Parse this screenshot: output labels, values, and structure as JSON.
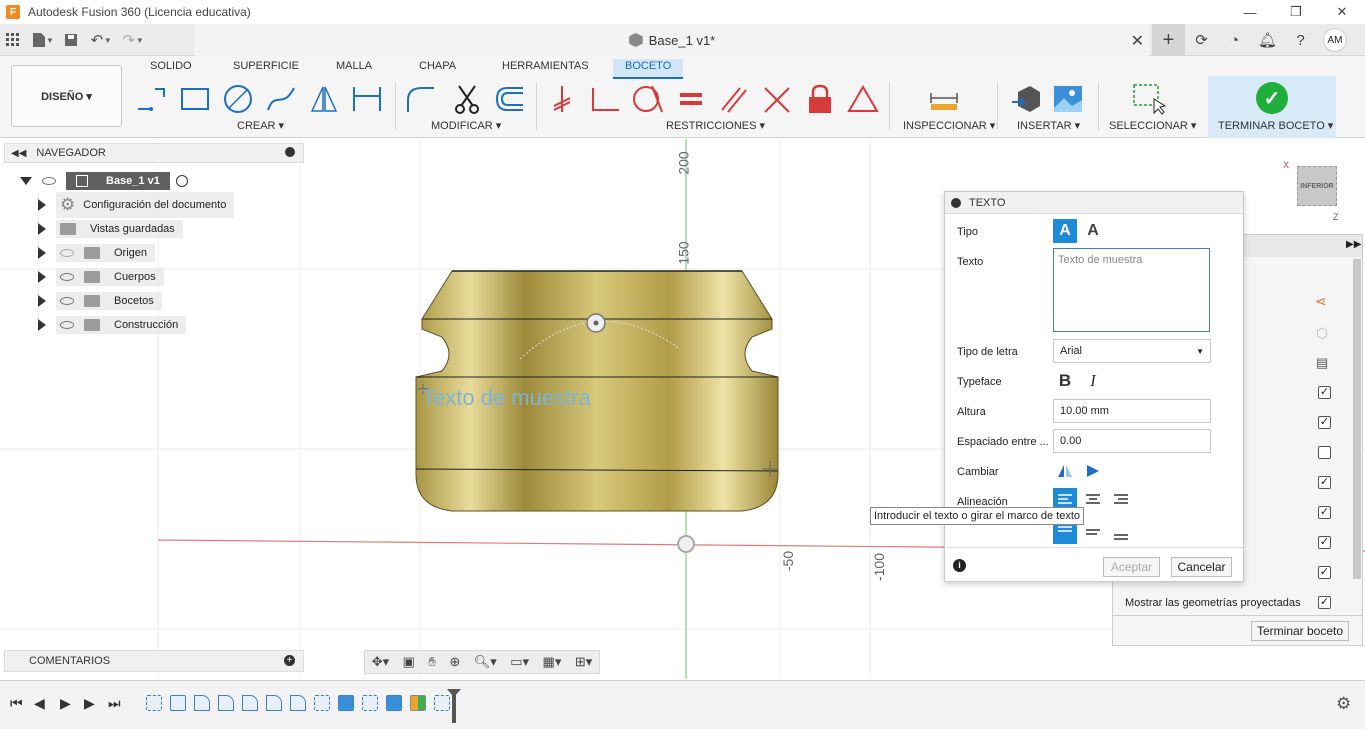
{
  "window": {
    "title": "Autodesk Fusion 360 (Licencia educativa)",
    "logo": "F",
    "controls": [
      "—",
      "❐",
      "✕"
    ]
  },
  "tabbar": {
    "document_name": "Base_1 v1*",
    "close": "✕",
    "user_initials": "AM"
  },
  "ribbon": {
    "workspace": "DISEÑO ▾",
    "tabs": [
      "SOLIDO",
      "SUPERFICIE",
      "MALLA",
      "CHAPA",
      "HERRAMIENTAS",
      "BOCETO"
    ],
    "active_tab": "BOCETO",
    "groups": {
      "crear": "CREAR ▾",
      "modificar": "MODIFICAR ▾",
      "restricciones": "RESTRICCIONES ▾",
      "inspeccionar": "INSPECCIONAR ▾",
      "insertar": "INSERTAR ▾",
      "seleccionar": "SELECCIONAR ▾",
      "terminar": "TERMINAR BOCETO ▾"
    },
    "accent": "#1b6db5",
    "finish_color": "#1fae3b"
  },
  "navigator": {
    "title": "NAVEGADOR",
    "root": "Base_1 v1",
    "items": [
      {
        "label": "Configuración del documento",
        "icon": "gear-icon"
      },
      {
        "label": "Vistas guardadas",
        "icon": "folder-icon"
      },
      {
        "label": "Origen",
        "icon": "folder-icon"
      },
      {
        "label": "Cuerpos",
        "icon": "folder-icon"
      },
      {
        "label": "Bocetos",
        "icon": "folder-icon"
      },
      {
        "label": "Construcción",
        "icon": "folder-icon"
      }
    ]
  },
  "comments": {
    "title": "COMENTARIOS"
  },
  "canvas": {
    "sketch_text": "Texto de muestra",
    "ruler_labels": [
      "200",
      "150",
      "-50",
      "-100"
    ]
  },
  "viewcube": {
    "face": "INFERIOR",
    "x": "X",
    "z": "Z"
  },
  "text_dialog": {
    "title": "TEXTO",
    "labels": {
      "tipo": "Tipo",
      "texto": "Texto",
      "tipo_letra": "Tipo de letra",
      "typeface": "Typeface",
      "altura": "Altura",
      "espaciado": "Espaciado entre ...",
      "cambiar": "Cambiar",
      "alineacion": "Alineación"
    },
    "text_placeholder": "Texto de muestra",
    "font_value": "Arial",
    "height_value": "10.00 mm",
    "spacing_value": "0.00",
    "ok_label": "Aceptar",
    "cancel_label": "Cancelar"
  },
  "tooltip": "Introducir el texto o girar el marco de texto",
  "palette": {
    "last_option": "Mostrar las geometrías proyectadas",
    "finish_button": "Terminar boceto"
  }
}
